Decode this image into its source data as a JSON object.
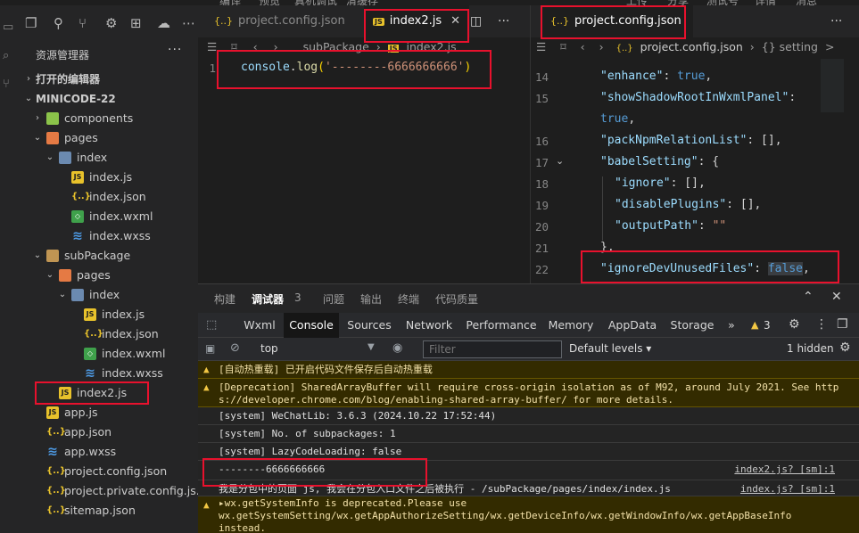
{
  "menubar": [
    "编译",
    "预览",
    "真机调试",
    "清缓存",
    "上传",
    "分享",
    "测试号",
    "详情",
    "消息"
  ],
  "sidebar": {
    "title": "资源管理器",
    "more": "···",
    "open_editors": "打开的编辑器",
    "project": "MINICODE-22",
    "tree": [
      {
        "label": "components",
        "icon": "folder-components-icon",
        "indent": 1,
        "chev": "›"
      },
      {
        "label": "pages",
        "icon": "folder-pages-icon",
        "indent": 1,
        "chev": "⌄"
      },
      {
        "label": "index",
        "icon": "folder-index-icon",
        "indent": 2,
        "chev": "⌄"
      },
      {
        "label": "index.js",
        "icon": "js-file-icon",
        "indent": 3
      },
      {
        "label": "index.json",
        "icon": "json-file-icon",
        "indent": 3
      },
      {
        "label": "index.wxml",
        "icon": "wxml-file-icon",
        "indent": 3
      },
      {
        "label": "index.wxss",
        "icon": "wxss-file-icon",
        "indent": 3
      },
      {
        "label": "subPackage",
        "icon": "folder-icon",
        "indent": 1,
        "chev": "⌄"
      },
      {
        "label": "pages",
        "icon": "folder-pages-icon",
        "indent": 2,
        "chev": "⌄"
      },
      {
        "label": "index",
        "icon": "folder-index-icon",
        "indent": 3,
        "chev": "⌄"
      },
      {
        "label": "index.js",
        "icon": "js-file-icon",
        "indent": 4
      },
      {
        "label": "index.json",
        "icon": "json-file-icon",
        "indent": 4
      },
      {
        "label": "index.wxml",
        "icon": "wxml-file-icon",
        "indent": 4
      },
      {
        "label": "index.wxss",
        "icon": "wxss-file-icon",
        "indent": 4
      },
      {
        "label": "index2.js",
        "icon": "js-file-icon",
        "indent": 2
      },
      {
        "label": "app.js",
        "icon": "js-file-icon",
        "indent": 1
      },
      {
        "label": "app.json",
        "icon": "json-file-icon",
        "indent": 1
      },
      {
        "label": "app.wxss",
        "icon": "wxss-file-icon",
        "indent": 1
      },
      {
        "label": "project.config.json",
        "icon": "json-file-icon",
        "indent": 1
      },
      {
        "label": "project.private.config.js...",
        "icon": "json-file-icon",
        "indent": 1
      },
      {
        "label": "sitemap.json",
        "icon": "json-file-icon",
        "indent": 1
      }
    ]
  },
  "editor_left": {
    "tabs": [
      {
        "label": "project.config.json",
        "icon": "{..}"
      },
      {
        "label": "index2.js",
        "icon": "JS",
        "close": "✕"
      }
    ],
    "split": "◫",
    "more": "···",
    "breadcrumb": [
      "subPackage",
      "index2.js"
    ],
    "line_number": "1",
    "code": {
      "obj": "console",
      "dot": ".",
      "fn": "log",
      "open": "(",
      "str": "'--------6666666666'",
      "close": ")"
    }
  },
  "editor_right": {
    "tab": {
      "label": "project.config.json",
      "icon": "{..}"
    },
    "more": "···",
    "breadcrumb": [
      "project.config.json",
      "{} setting",
      ">"
    ],
    "lines": [
      {
        "n": "14",
        "key": "\"enhance\"",
        "val": "true",
        "kind": "kw",
        "indent": 0,
        "tail": ","
      },
      {
        "n": "15",
        "key": "\"showShadowRootInWxmlPanel\"",
        "val": "",
        "kind": "kw",
        "indent": 0,
        "tail": ":"
      },
      {
        "n": "",
        "key": "",
        "val": "true",
        "kind": "kw",
        "indent": 0,
        "tail": ","
      },
      {
        "n": "16",
        "key": "\"packNpmRelationList\"",
        "val": "[]",
        "kind": "punc",
        "indent": 0,
        "tail": ","
      },
      {
        "n": "17",
        "key": "\"babelSetting\"",
        "val": "{",
        "kind": "punc",
        "indent": 0,
        "tail": ""
      },
      {
        "n": "18",
        "key": "\"ignore\"",
        "val": "[]",
        "kind": "punc",
        "indent": 1,
        "tail": ","
      },
      {
        "n": "19",
        "key": "\"disablePlugins\"",
        "val": "[]",
        "kind": "punc",
        "indent": 1,
        "tail": ","
      },
      {
        "n": "20",
        "key": "\"outputPath\"",
        "val": "\"\"",
        "kind": "str",
        "indent": 1,
        "tail": ""
      },
      {
        "n": "21",
        "key": "",
        "val": "},",
        "kind": "punc",
        "indent": 0,
        "tail": ""
      },
      {
        "n": "22",
        "key": "\"ignoreDevUnusedFiles\"",
        "val": "false",
        "kind": "kw",
        "indent": 0,
        "tail": ","
      }
    ]
  },
  "panel": {
    "tabs": [
      "构建",
      "调试器",
      "问题",
      "输出",
      "终端",
      "代码质量"
    ],
    "debugger_count": "3",
    "devtools_tabs": [
      "Wxml",
      "Console",
      "Sources",
      "Network",
      "Performance",
      "Memory",
      "AppData",
      "Storage"
    ],
    "overflow": "»",
    "warning_count": "3",
    "context": "top",
    "filter_placeholder": "Filter",
    "levels": "Default levels ▾",
    "hidden": "1 hidden",
    "logs": [
      {
        "type": "warn",
        "text": "[自动热重载] 已开启代码文件保存后自动热重载",
        "src": ""
      },
      {
        "type": "warn",
        "text": "[Deprecation] SharedArrayBuffer will require cross-origin isolation as of M92, around July 2021. See http\ns://developer.chrome.com/blog/enabling-shared-array-buffer/ for more details.",
        "src": ""
      },
      {
        "type": "log",
        "text": "[system] WeChatLib: 3.6.3 (2024.10.22 17:52:44)",
        "src": ""
      },
      {
        "type": "log",
        "text": "[system] No. of subpackages: 1",
        "src": ""
      },
      {
        "type": "log",
        "text": "[system] LazyCodeLoading: false",
        "src": ""
      },
      {
        "type": "log",
        "text": "--------6666666666",
        "src": "index2.js? [sm]:1"
      },
      {
        "type": "log",
        "text": "我是分包中的页面 js, 我会在分包入口文件之后被执行 - /subPackage/pages/index/index.js",
        "src": "index.js? [sm]:1"
      },
      {
        "type": "warn",
        "text": "▸wx.getSystemInfo is deprecated.Please use\nwx.getSystemSetting/wx.getAppAuthorizeSetting/wx.getDeviceInfo/wx.getWindowInfo/wx.getAppBaseInfo\ninstead.",
        "src": ""
      }
    ]
  },
  "colors": {
    "highlight": "#e8112d",
    "accent": "#007acc",
    "warn": "#f2c744"
  }
}
